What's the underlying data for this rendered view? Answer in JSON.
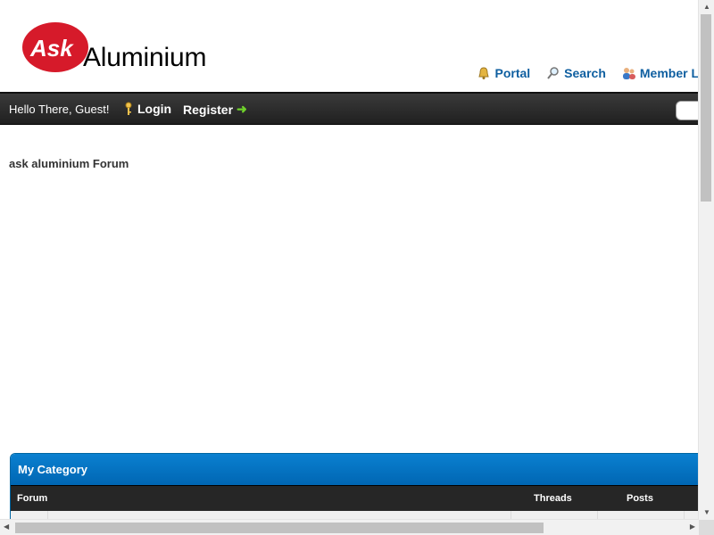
{
  "header": {
    "logo_word": "Ask",
    "site_title": "Aluminium",
    "top_links": [
      {
        "label": "Portal",
        "icon": "bell-icon"
      },
      {
        "label": "Search",
        "icon": "magnifier-icon"
      },
      {
        "label": "Member L",
        "icon": "members-icon"
      }
    ]
  },
  "panel": {
    "welcome": "Hello There, Guest!",
    "login": "Login",
    "register": "Register"
  },
  "main": {
    "forum_title": "ask aluminium Forum"
  },
  "category": {
    "title": "My Category",
    "columns": {
      "forum": "Forum",
      "threads": "Threads",
      "posts": "Posts"
    }
  },
  "colors": {
    "brand_red": "#d61a2a",
    "link_blue": "#0f5fa0",
    "panel_dark": "#222222",
    "category_blue": "#0074c6"
  }
}
